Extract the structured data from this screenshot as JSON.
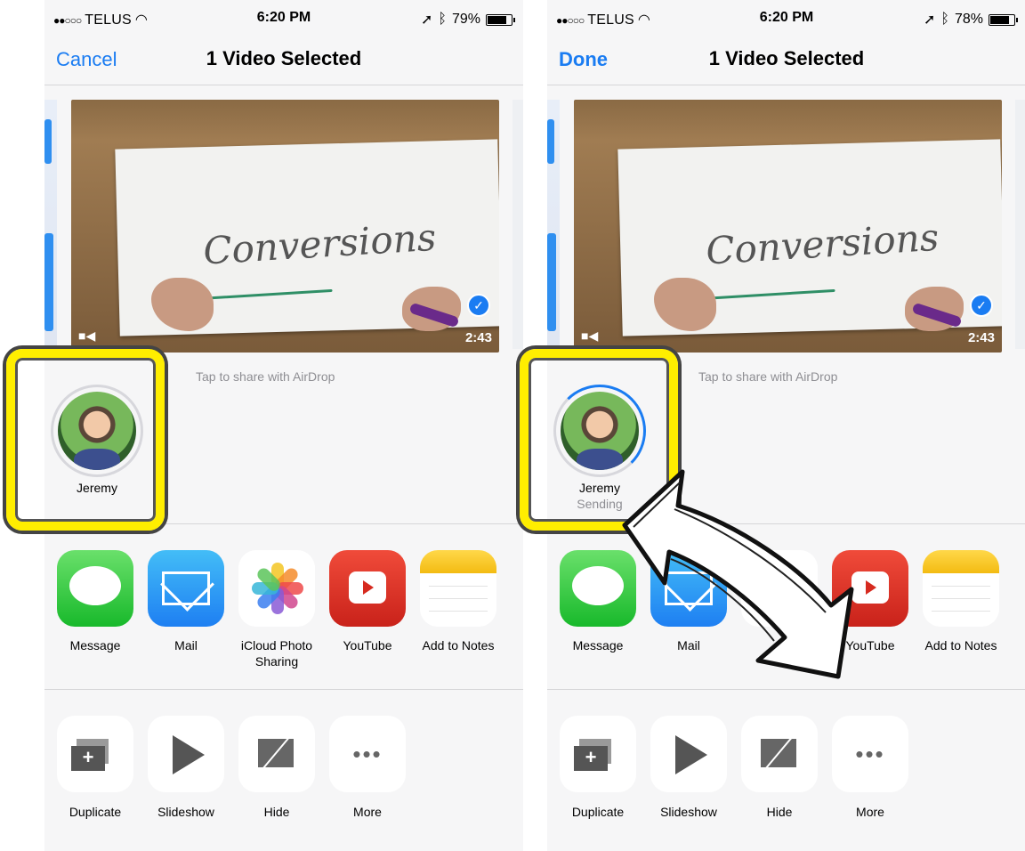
{
  "screens": [
    {
      "status": {
        "signal": "●●○○○",
        "carrier": "TELUS",
        "time": "6:20 PM",
        "battery": "79%"
      },
      "nav": {
        "left_button": "Cancel",
        "title": "1 Video Selected"
      },
      "video": {
        "board_text": "Conversions",
        "duration": "2:43",
        "selected_icon": "checkmark-icon"
      },
      "airdrop": {
        "caption": "Tap to share with AirDrop",
        "person_name": "Jeremy",
        "person_status": ""
      },
      "apps": [
        {
          "label": "Message",
          "icon": "message-icon"
        },
        {
          "label": "Mail",
          "icon": "mail-icon"
        },
        {
          "label": "iCloud Photo",
          "label2": "Sharing",
          "icon": "photos-icon"
        },
        {
          "label": "YouTube",
          "icon": "youtube-icon"
        },
        {
          "label": "Add to Notes",
          "icon": "notes-icon"
        }
      ],
      "actions": [
        {
          "label": "Duplicate",
          "icon": "duplicate-icon"
        },
        {
          "label": "Slideshow",
          "icon": "play-icon"
        },
        {
          "label": "Hide",
          "icon": "hide-icon"
        },
        {
          "label": "More",
          "icon": "more-icon"
        }
      ]
    },
    {
      "status": {
        "signal": "●●○○○",
        "carrier": "TELUS",
        "time": "6:20 PM",
        "battery": "78%"
      },
      "nav": {
        "left_button": "Done",
        "title": "1 Video Selected"
      },
      "video": {
        "board_text": "Conversions",
        "duration": "2:43",
        "selected_icon": "checkmark-icon"
      },
      "airdrop": {
        "caption": "Tap to share with AirDrop",
        "person_name": "Jeremy",
        "person_status": "Sending"
      },
      "apps": [
        {
          "label": "Message",
          "icon": "message-icon"
        },
        {
          "label": "Mail",
          "icon": "mail-icon"
        },
        {
          "label": "",
          "label2": "",
          "icon": "photos-icon"
        },
        {
          "label": "YouTube",
          "icon": "youtube-icon"
        },
        {
          "label": "Add to Notes",
          "icon": "notes-icon"
        }
      ],
      "actions": [
        {
          "label": "Duplicate",
          "icon": "duplicate-icon"
        },
        {
          "label": "Slideshow",
          "icon": "play-icon"
        },
        {
          "label": "Hide",
          "icon": "hide-icon"
        },
        {
          "label": "More",
          "icon": "more-icon"
        }
      ]
    }
  ],
  "annotations": {
    "highlight_color": "#ffee00",
    "accent": "#1a7cf2"
  }
}
